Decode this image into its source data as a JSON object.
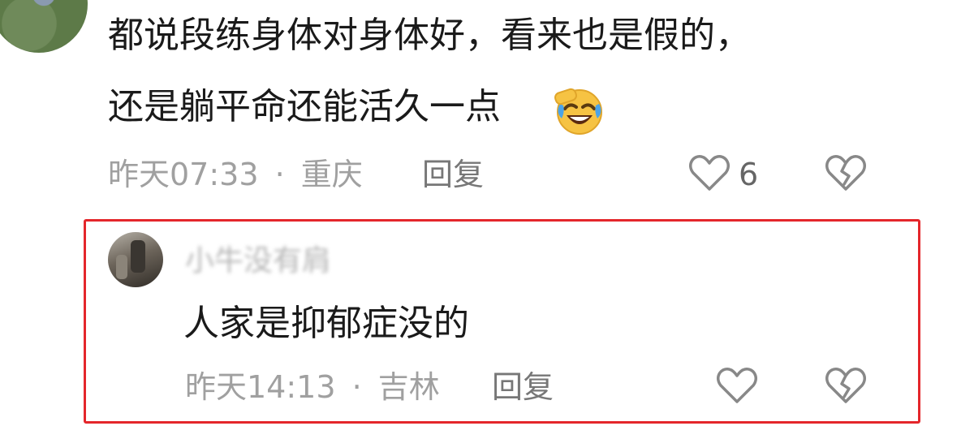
{
  "comment": {
    "lines": [
      "都说段练身体对身体好，看来也是假的，",
      "还是躺平命还能活久一点"
    ],
    "emoji": "laughing-crying-emoji",
    "time": "昨天07:33",
    "separator": "·",
    "location": "重庆",
    "reply_label": "回复",
    "like_count": "6"
  },
  "reply": {
    "username": "小牛没有肩",
    "text": "人家是抑郁症没的",
    "time": "昨天14:13",
    "separator": "·",
    "location": "吉林",
    "reply_label": "回复"
  },
  "icons": {
    "like": "heart-outline-icon",
    "dislike": "broken-heart-icon"
  },
  "colors": {
    "highlight_border": "#e4262b",
    "meta_text": "#a0a0a0",
    "body_text": "#1a1a1a"
  }
}
